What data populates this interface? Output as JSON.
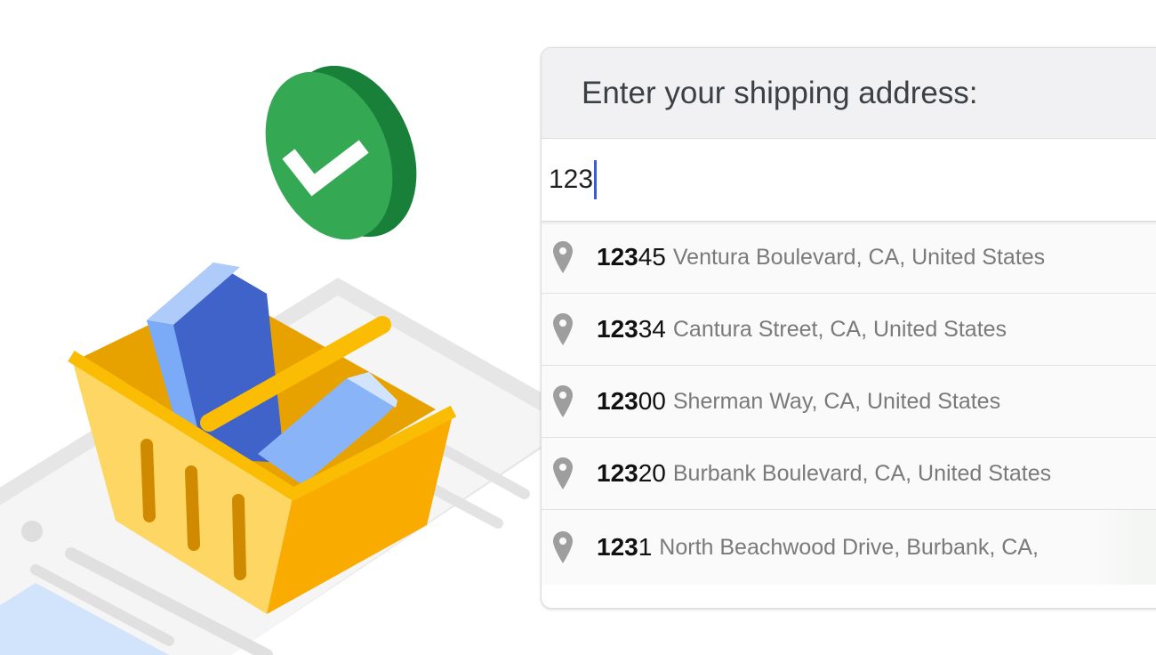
{
  "form": {
    "title": "Enter your shipping address:",
    "input_value": "123"
  },
  "suggestions": [
    {
      "match": "123",
      "rest": "45",
      "street": "Ventura Boulevard, CA, United States"
    },
    {
      "match": "123",
      "rest": "34",
      "street": "Cantura Street, CA, United States"
    },
    {
      "match": "123",
      "rest": "00",
      "street": "Sherman Way, CA, United States"
    },
    {
      "match": "123",
      "rest": "20",
      "street": "Burbank Boulevard, CA, United States"
    },
    {
      "match": "123",
      "rest": "1",
      "street": "North Beachwood Drive, Burbank, CA,"
    }
  ],
  "icons": {
    "suggestion_icon": "map-pin-icon",
    "illustration_badge": "checkmark-icon",
    "illustration_object": "shopping-basket"
  },
  "colors": {
    "check_green": "#34a853",
    "basket_yellow": "#f9ab00",
    "caret_blue": "#3b5bdb"
  }
}
